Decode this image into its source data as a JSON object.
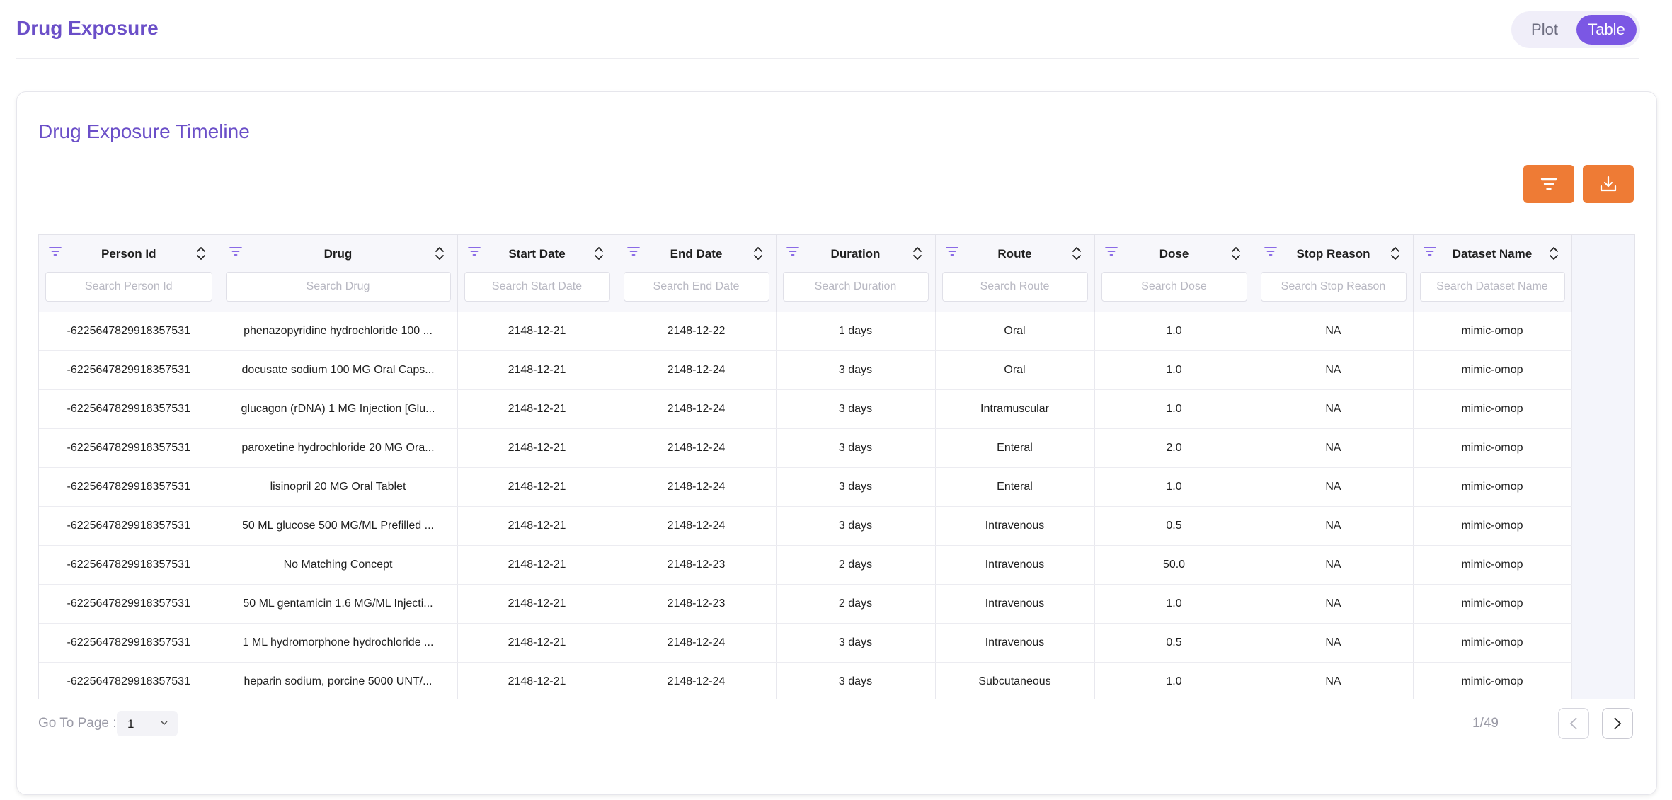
{
  "page": {
    "title": "Drug Exposure"
  },
  "view_toggle": {
    "plot_label": "Plot",
    "table_label": "Table",
    "selected": "Table"
  },
  "card": {
    "title": "Drug Exposure Timeline"
  },
  "toolbar": {
    "filter_icon": "filter-icon",
    "download_icon": "download-icon",
    "accent": "#ee7b35"
  },
  "columns": [
    {
      "label": "Person Id",
      "placeholder": "Search Person Id"
    },
    {
      "label": "Drug",
      "placeholder": "Search Drug"
    },
    {
      "label": "Start Date",
      "placeholder": "Search Start Date"
    },
    {
      "label": "End Date",
      "placeholder": "Search End Date"
    },
    {
      "label": "Duration",
      "placeholder": "Search Duration"
    },
    {
      "label": "Route",
      "placeholder": "Search Route"
    },
    {
      "label": "Dose",
      "placeholder": "Search Dose"
    },
    {
      "label": "Stop Reason",
      "placeholder": "Search Stop Reason"
    },
    {
      "label": "Dataset Name",
      "placeholder": "Search Dataset Name"
    }
  ],
  "rows": [
    [
      "-6225647829918357531",
      "phenazopyridine hydrochloride 100 ...",
      "2148-12-21",
      "2148-12-22",
      "1 days",
      "Oral",
      "1.0",
      "NA",
      "mimic-omop"
    ],
    [
      "-6225647829918357531",
      "docusate sodium 100 MG Oral Caps...",
      "2148-12-21",
      "2148-12-24",
      "3 days",
      "Oral",
      "1.0",
      "NA",
      "mimic-omop"
    ],
    [
      "-6225647829918357531",
      "glucagon (rDNA) 1 MG Injection [Glu...",
      "2148-12-21",
      "2148-12-24",
      "3 days",
      "Intramuscular",
      "1.0",
      "NA",
      "mimic-omop"
    ],
    [
      "-6225647829918357531",
      "paroxetine hydrochloride 20 MG Ora...",
      "2148-12-21",
      "2148-12-24",
      "3 days",
      "Enteral",
      "2.0",
      "NA",
      "mimic-omop"
    ],
    [
      "-6225647829918357531",
      "lisinopril 20 MG Oral Tablet",
      "2148-12-21",
      "2148-12-24",
      "3 days",
      "Enteral",
      "1.0",
      "NA",
      "mimic-omop"
    ],
    [
      "-6225647829918357531",
      "50 ML glucose 500 MG/ML Prefilled ...",
      "2148-12-21",
      "2148-12-24",
      "3 days",
      "Intravenous",
      "0.5",
      "NA",
      "mimic-omop"
    ],
    [
      "-6225647829918357531",
      "No Matching Concept",
      "2148-12-21",
      "2148-12-23",
      "2 days",
      "Intravenous",
      "50.0",
      "NA",
      "mimic-omop"
    ],
    [
      "-6225647829918357531",
      "50 ML gentamicin 1.6 MG/ML Injecti...",
      "2148-12-21",
      "2148-12-23",
      "2 days",
      "Intravenous",
      "1.0",
      "NA",
      "mimic-omop"
    ],
    [
      "-6225647829918357531",
      "1 ML hydromorphone hydrochloride ...",
      "2148-12-21",
      "2148-12-24",
      "3 days",
      "Intravenous",
      "0.5",
      "NA",
      "mimic-omop"
    ],
    [
      "-6225647829918357531",
      "heparin sodium, porcine 5000 UNT/...",
      "2148-12-21",
      "2148-12-24",
      "3 days",
      "Subcutaneous",
      "1.0",
      "NA",
      "mimic-omop"
    ]
  ],
  "pagination": {
    "go_to_label": "Go To Page :",
    "current_page": "1",
    "page_count": "1/49"
  },
  "theme": {
    "primary": "#7b57e4",
    "title_color": "#6b4fc8"
  }
}
